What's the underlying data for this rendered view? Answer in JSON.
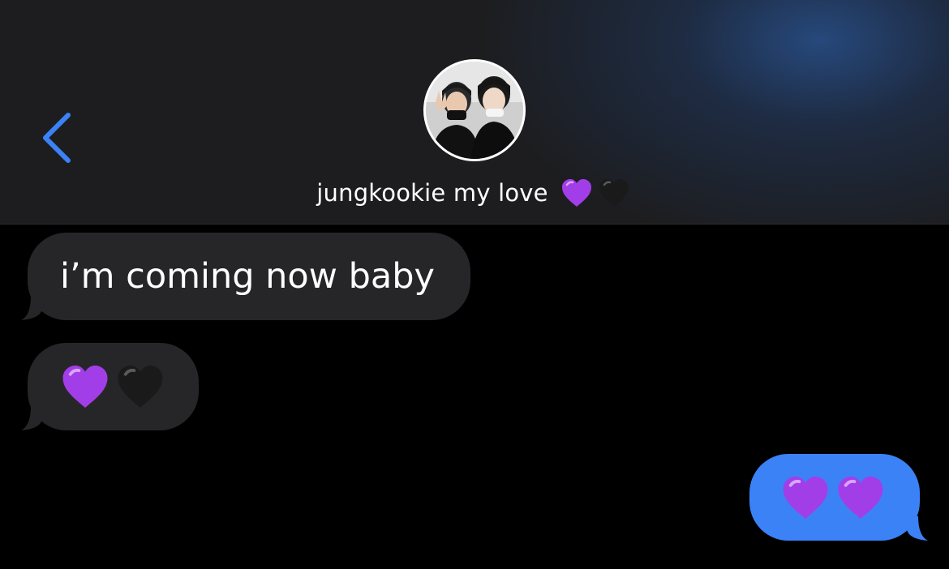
{
  "header": {
    "back_icon": "chevron-left-icon",
    "contact_name": "jungkookie my love",
    "name_hearts": [
      "purple-heart-icon",
      "black-heart-icon"
    ],
    "avatar": "contact-avatar-photo"
  },
  "messages": [
    {
      "direction": "received",
      "text": "i’m coming now baby"
    },
    {
      "direction": "received",
      "emojis": [
        "purple-heart-icon",
        "black-heart-icon"
      ]
    },
    {
      "direction": "sent",
      "emojis": [
        "purple-heart-icon",
        "purple-heart-icon"
      ]
    }
  ],
  "colors": {
    "accent": "#3b82f6",
    "received_bubble": "#262628",
    "header_bg": "#1d1d1f",
    "background": "#000000",
    "purple_heart": "#a23ee8",
    "black_heart": "#1a1a1a"
  }
}
